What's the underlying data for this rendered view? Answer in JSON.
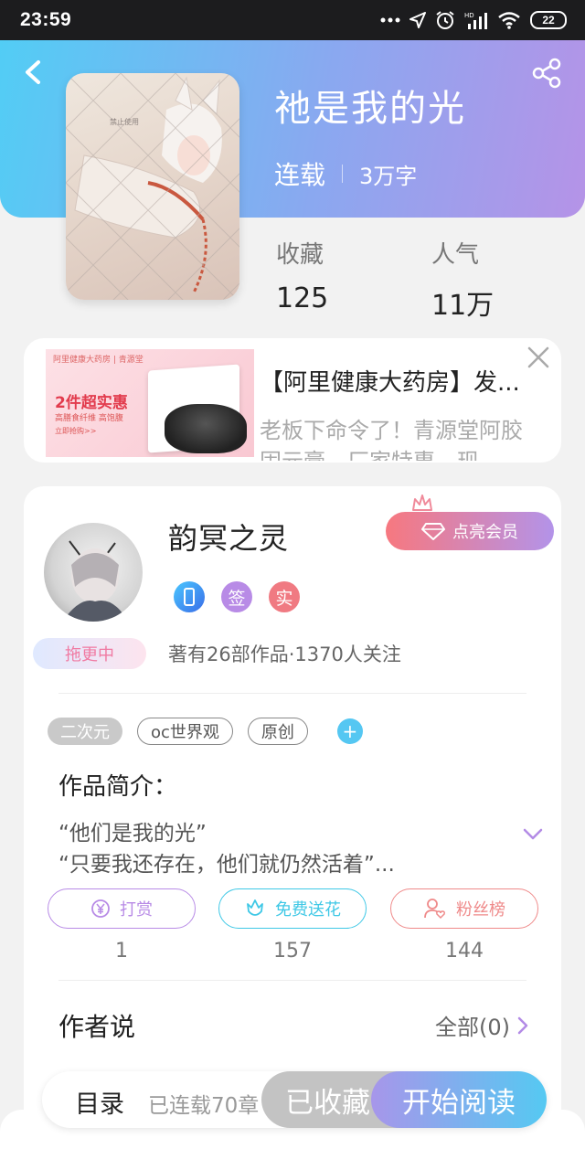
{
  "status_bar": {
    "time": "23:59",
    "battery": "22",
    "icons": [
      "more-dots-icon",
      "location-icon",
      "alarm-icon",
      "signal-icon",
      "wifi-icon",
      "battery-icon"
    ]
  },
  "book": {
    "title": "祂是我的光",
    "status": "连载",
    "word_count": "3万字",
    "cover_watermark": "禁止使用",
    "stats": [
      {
        "label": "收藏",
        "value": "125"
      },
      {
        "label": "人气",
        "value": "11万"
      }
    ]
  },
  "ad": {
    "title": "【阿里健康大药房】发...",
    "description": "老板下命令了！青源堂阿胶固元膏，厂家特惠，现",
    "image_header": "阿里健康大药房 | 青源堂",
    "image_headline": "2件超实惠",
    "image_subline": "高膳食纤维 高饱腹",
    "image_link": "立即抢购>>"
  },
  "author": {
    "name": "韵冥之灵",
    "status_badge": "拖更中",
    "badges": [
      "签",
      "实"
    ],
    "stats_text": "著有26部作品·1370人关注",
    "vip_label": "点亮会员"
  },
  "tags": [
    "二次元",
    "oc世界观",
    "原创"
  ],
  "intro": {
    "heading": "作品简介：",
    "lines": [
      "“他们是我的光”",
      "“只要我还存在，他们就仍然活着”..."
    ]
  },
  "actions": [
    {
      "label": "打赏",
      "count": "1",
      "color": "#b88be6"
    },
    {
      "label": "免费送花",
      "count": "157",
      "color": "#3fc8e6"
    },
    {
      "label": "粉丝榜",
      "count": "144",
      "color": "#ef8a8a"
    }
  ],
  "author_says": {
    "heading": "作者说",
    "all_label": "全部(0)"
  },
  "bottom_bar": {
    "toc": "目录",
    "serial": "已连载70章",
    "collected": "已收藏",
    "read": "开始阅读"
  },
  "colors": {
    "hero_start": "#52cdf5",
    "hero_end": "#b593e7",
    "accent_blue": "#55c7f2",
    "accent_purple": "#a796ea"
  }
}
